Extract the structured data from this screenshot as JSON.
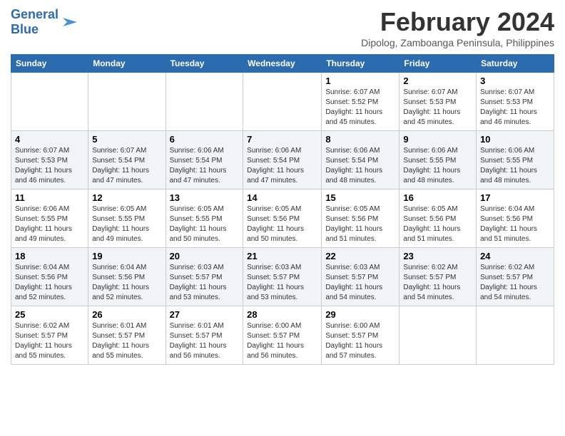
{
  "logo": {
    "line1": "General",
    "line2": "Blue"
  },
  "title": "February 2024",
  "subtitle": "Dipolog, Zamboanga Peninsula, Philippines",
  "days_header": [
    "Sunday",
    "Monday",
    "Tuesday",
    "Wednesday",
    "Thursday",
    "Friday",
    "Saturday"
  ],
  "weeks": [
    [
      {
        "day": "",
        "info": ""
      },
      {
        "day": "",
        "info": ""
      },
      {
        "day": "",
        "info": ""
      },
      {
        "day": "",
        "info": ""
      },
      {
        "day": "1",
        "info": "Sunrise: 6:07 AM\nSunset: 5:52 PM\nDaylight: 11 hours and 45 minutes."
      },
      {
        "day": "2",
        "info": "Sunrise: 6:07 AM\nSunset: 5:53 PM\nDaylight: 11 hours and 45 minutes."
      },
      {
        "day": "3",
        "info": "Sunrise: 6:07 AM\nSunset: 5:53 PM\nDaylight: 11 hours and 46 minutes."
      }
    ],
    [
      {
        "day": "4",
        "info": "Sunrise: 6:07 AM\nSunset: 5:53 PM\nDaylight: 11 hours and 46 minutes."
      },
      {
        "day": "5",
        "info": "Sunrise: 6:07 AM\nSunset: 5:54 PM\nDaylight: 11 hours and 47 minutes."
      },
      {
        "day": "6",
        "info": "Sunrise: 6:06 AM\nSunset: 5:54 PM\nDaylight: 11 hours and 47 minutes."
      },
      {
        "day": "7",
        "info": "Sunrise: 6:06 AM\nSunset: 5:54 PM\nDaylight: 11 hours and 47 minutes."
      },
      {
        "day": "8",
        "info": "Sunrise: 6:06 AM\nSunset: 5:54 PM\nDaylight: 11 hours and 48 minutes."
      },
      {
        "day": "9",
        "info": "Sunrise: 6:06 AM\nSunset: 5:55 PM\nDaylight: 11 hours and 48 minutes."
      },
      {
        "day": "10",
        "info": "Sunrise: 6:06 AM\nSunset: 5:55 PM\nDaylight: 11 hours and 48 minutes."
      }
    ],
    [
      {
        "day": "11",
        "info": "Sunrise: 6:06 AM\nSunset: 5:55 PM\nDaylight: 11 hours and 49 minutes."
      },
      {
        "day": "12",
        "info": "Sunrise: 6:05 AM\nSunset: 5:55 PM\nDaylight: 11 hours and 49 minutes."
      },
      {
        "day": "13",
        "info": "Sunrise: 6:05 AM\nSunset: 5:55 PM\nDaylight: 11 hours and 50 minutes."
      },
      {
        "day": "14",
        "info": "Sunrise: 6:05 AM\nSunset: 5:56 PM\nDaylight: 11 hours and 50 minutes."
      },
      {
        "day": "15",
        "info": "Sunrise: 6:05 AM\nSunset: 5:56 PM\nDaylight: 11 hours and 51 minutes."
      },
      {
        "day": "16",
        "info": "Sunrise: 6:05 AM\nSunset: 5:56 PM\nDaylight: 11 hours and 51 minutes."
      },
      {
        "day": "17",
        "info": "Sunrise: 6:04 AM\nSunset: 5:56 PM\nDaylight: 11 hours and 51 minutes."
      }
    ],
    [
      {
        "day": "18",
        "info": "Sunrise: 6:04 AM\nSunset: 5:56 PM\nDaylight: 11 hours and 52 minutes."
      },
      {
        "day": "19",
        "info": "Sunrise: 6:04 AM\nSunset: 5:56 PM\nDaylight: 11 hours and 52 minutes."
      },
      {
        "day": "20",
        "info": "Sunrise: 6:03 AM\nSunset: 5:57 PM\nDaylight: 11 hours and 53 minutes."
      },
      {
        "day": "21",
        "info": "Sunrise: 6:03 AM\nSunset: 5:57 PM\nDaylight: 11 hours and 53 minutes."
      },
      {
        "day": "22",
        "info": "Sunrise: 6:03 AM\nSunset: 5:57 PM\nDaylight: 11 hours and 54 minutes."
      },
      {
        "day": "23",
        "info": "Sunrise: 6:02 AM\nSunset: 5:57 PM\nDaylight: 11 hours and 54 minutes."
      },
      {
        "day": "24",
        "info": "Sunrise: 6:02 AM\nSunset: 5:57 PM\nDaylight: 11 hours and 54 minutes."
      }
    ],
    [
      {
        "day": "25",
        "info": "Sunrise: 6:02 AM\nSunset: 5:57 PM\nDaylight: 11 hours and 55 minutes."
      },
      {
        "day": "26",
        "info": "Sunrise: 6:01 AM\nSunset: 5:57 PM\nDaylight: 11 hours and 55 minutes."
      },
      {
        "day": "27",
        "info": "Sunrise: 6:01 AM\nSunset: 5:57 PM\nDaylight: 11 hours and 56 minutes."
      },
      {
        "day": "28",
        "info": "Sunrise: 6:00 AM\nSunset: 5:57 PM\nDaylight: 11 hours and 56 minutes."
      },
      {
        "day": "29",
        "info": "Sunrise: 6:00 AM\nSunset: 5:57 PM\nDaylight: 11 hours and 57 minutes."
      },
      {
        "day": "",
        "info": ""
      },
      {
        "day": "",
        "info": ""
      }
    ]
  ]
}
